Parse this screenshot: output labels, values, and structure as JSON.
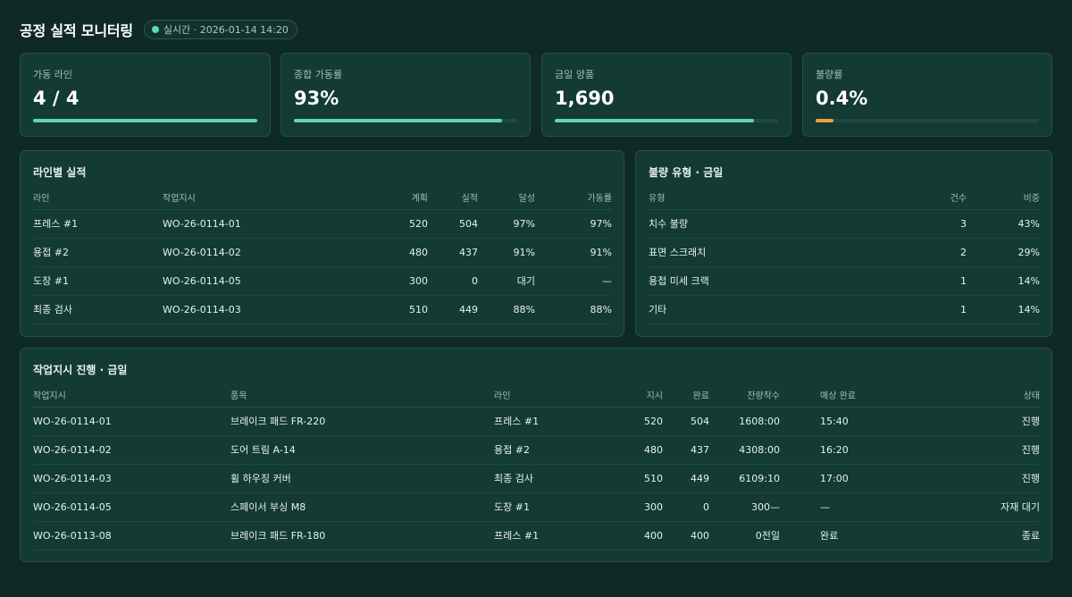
{
  "header": {
    "title": "공정 실적 모니터링",
    "live_badge": "실시간 · 2026-01-14 14:20"
  },
  "kpis": [
    {
      "label": "가동 라인",
      "value": "4 / 4",
      "progress": 1.0,
      "color": "#5fd6b8"
    },
    {
      "label": "종합 가동률",
      "value": "93%",
      "progress": 0.93,
      "color": "#5fd6b8"
    },
    {
      "label": "금일 양품",
      "value": "1,690",
      "progress": 0.89,
      "color": "#5fd6b8"
    },
    {
      "label": "불량률",
      "value": "0.4%",
      "progress": 0.08,
      "color": "#e8a23a"
    }
  ],
  "line_panel": {
    "title": "라인별 실적",
    "columns": [
      "라인",
      "작업지시",
      "계획",
      "실적",
      "달성",
      "가동률"
    ],
    "rows": [
      [
        "프레스 #1",
        "WO-26-0114-01",
        "520",
        "504",
        "97%",
        "97%"
      ],
      [
        "용접 #2",
        "WO-26-0114-02",
        "480",
        "437",
        "91%",
        "91%"
      ],
      [
        "도장 #1",
        "WO-26-0114-05",
        "300",
        "0",
        "대기",
        "—"
      ],
      [
        "최종 검사",
        "WO-26-0114-03",
        "510",
        "449",
        "88%",
        "88%"
      ]
    ]
  },
  "defect_panel": {
    "title": "불량 유형 · 금일",
    "columns": [
      "유형",
      "건수",
      "비중"
    ],
    "rows": [
      [
        "치수 불량",
        "3",
        "43%"
      ],
      [
        "표면 스크래치",
        "2",
        "29%"
      ],
      [
        "용접 미세 크랙",
        "1",
        "14%"
      ],
      [
        "기타",
        "1",
        "14%"
      ]
    ]
  },
  "work_panel": {
    "title": "작업지시 진행 · 금일",
    "columns": [
      "작업지시",
      "품목",
      "라인",
      "지시",
      "완료",
      "잔량착수",
      "예상 완료",
      "상태"
    ],
    "rows": [
      [
        "WO-26-0114-01",
        "브레이크 패드 FR-220",
        "프레스 #1",
        "520",
        "504",
        "1608:00",
        "15:40",
        "진행"
      ],
      [
        "WO-26-0114-02",
        "도어 트림 A-14",
        "용접 #2",
        "480",
        "437",
        "4308:00",
        "16:20",
        "진행"
      ],
      [
        "WO-26-0114-03",
        "휠 하우징 커버",
        "최종 검사",
        "510",
        "449",
        "6109:10",
        "17:00",
        "진행"
      ],
      [
        "WO-26-0114-05",
        "스페이서 부싱 M8",
        "도장 #1",
        "300",
        "0",
        "300—",
        "—",
        "자재 대기"
      ],
      [
        "WO-26-0113-08",
        "브레이크 패드 FR-180",
        "프레스 #1",
        "400",
        "400",
        "0전일",
        "완료",
        "종료"
      ]
    ]
  }
}
